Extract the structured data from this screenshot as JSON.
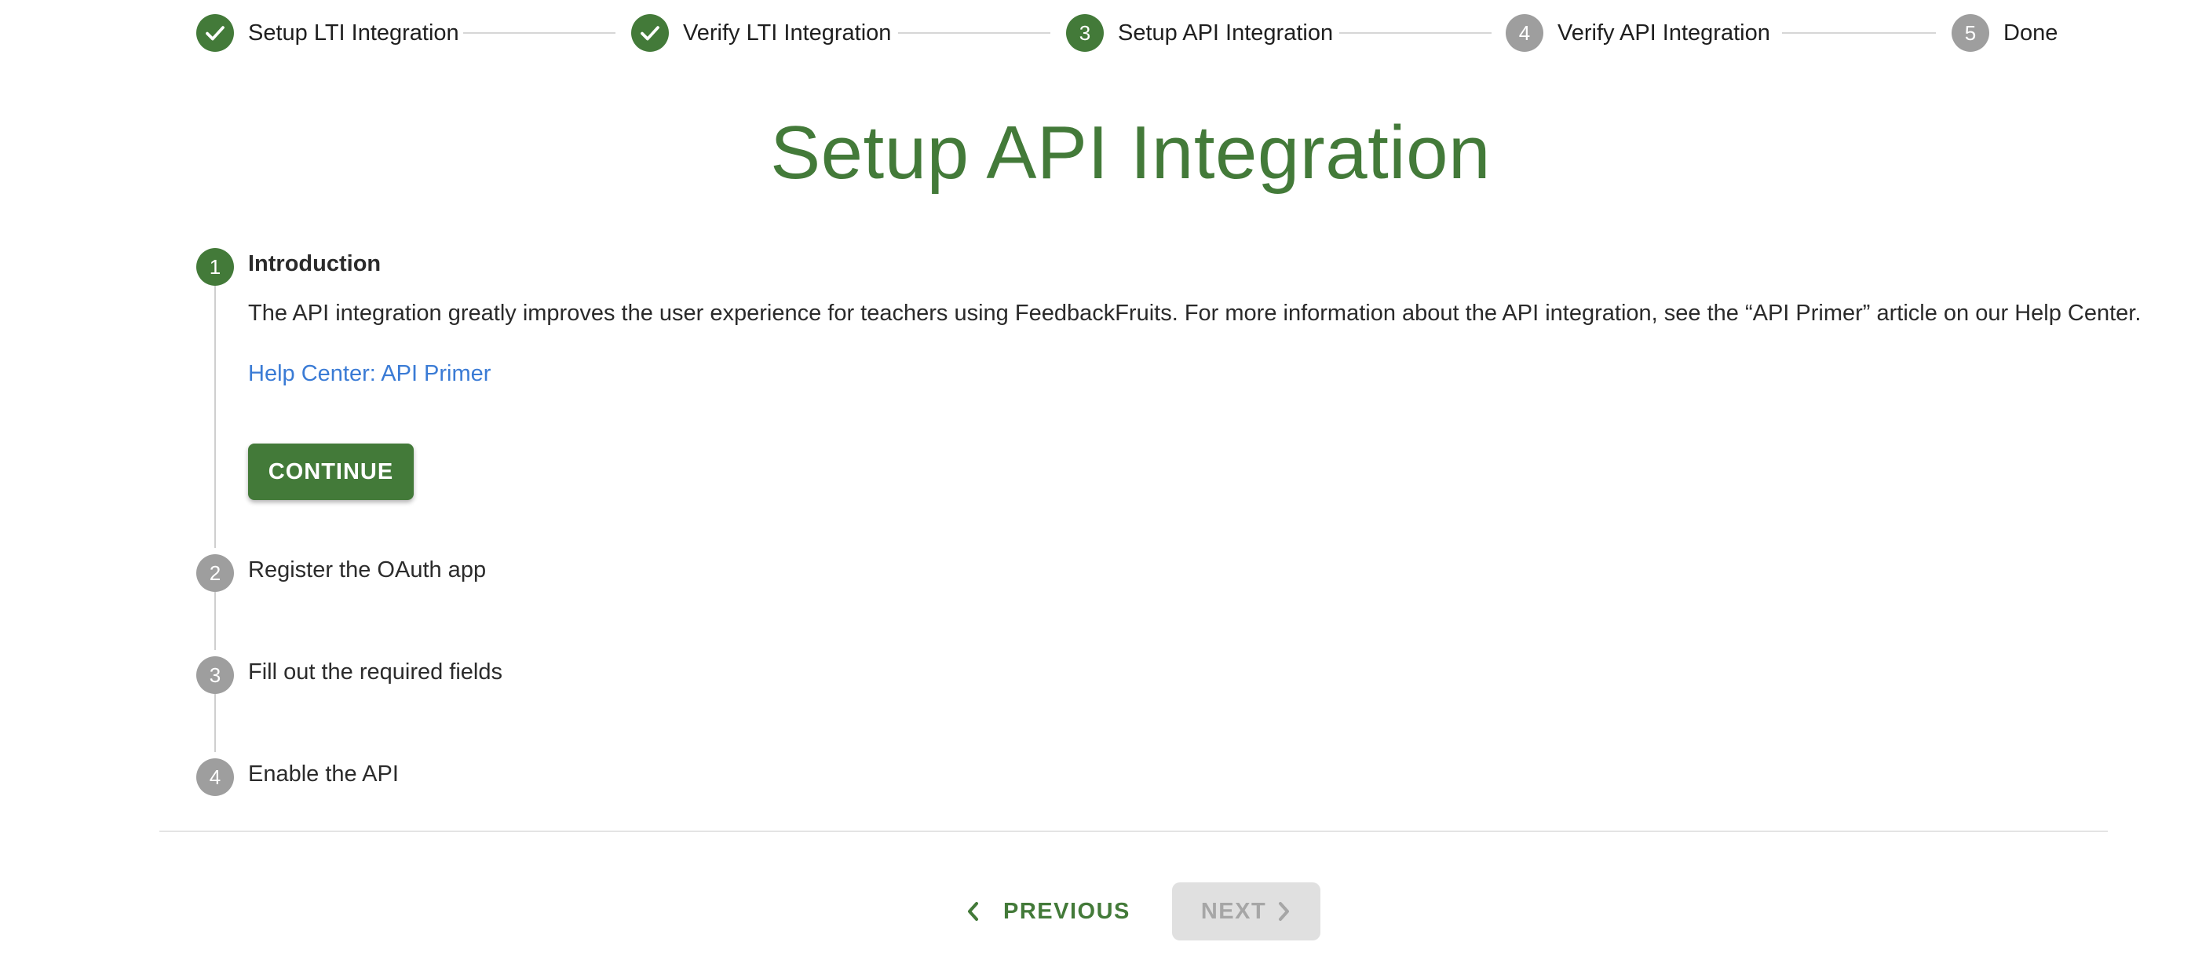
{
  "stepper": {
    "steps": [
      {
        "number": "1",
        "label": "Setup LTI Integration",
        "state": "done"
      },
      {
        "number": "2",
        "label": "Verify LTI Integration",
        "state": "done"
      },
      {
        "number": "3",
        "label": "Setup API Integration",
        "state": "active"
      },
      {
        "number": "4",
        "label": "Verify API Integration",
        "state": "todo"
      },
      {
        "number": "5",
        "label": "Done",
        "state": "todo"
      }
    ]
  },
  "page": {
    "title": "Setup API Integration"
  },
  "substeps": {
    "items": [
      {
        "number": "1",
        "label": "Introduction",
        "state": "active"
      },
      {
        "number": "2",
        "label": "Register the OAuth app",
        "state": "todo"
      },
      {
        "number": "3",
        "label": "Fill out the required fields",
        "state": "todo"
      },
      {
        "number": "4",
        "label": "Enable the API",
        "state": "todo"
      }
    ],
    "intro": {
      "description": "The API integration greatly improves the user experience for teachers using FeedbackFruits. For more information about the API integration, see the “API Primer” article on our Help Center.",
      "link_label": "Help Center: API Primer",
      "continue_label": "CONTINUE"
    }
  },
  "footer": {
    "previous_label": "PREVIOUS",
    "next_label": "NEXT",
    "next_disabled": true
  },
  "colors": {
    "accent": "#437a39",
    "inactive": "#9e9e9e",
    "link": "#3a7bd5"
  },
  "icons": {
    "done": "check-icon",
    "previous": "chevron-left-icon",
    "next": "chevron-right-icon"
  }
}
